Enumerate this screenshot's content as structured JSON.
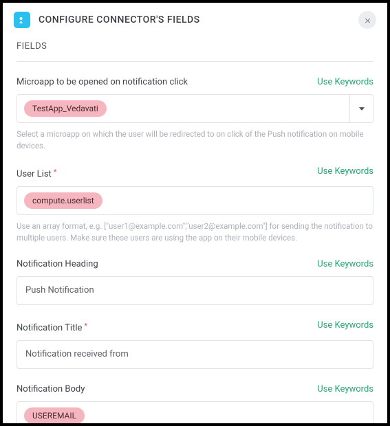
{
  "header": {
    "title": "CONFIGURE CONNECTOR'S FIELDS"
  },
  "section": {
    "label": "FIELDS"
  },
  "actions": {
    "use_keywords": "Use Keywords"
  },
  "fields": {
    "microapp": {
      "label": "Microapp to be opened on notification click",
      "value": "TestApp_Vedavati",
      "helper": "Select a microapp on which the user will be redirected to on click of the Push notification on mobile devices."
    },
    "userlist": {
      "label": "User List",
      "value": "compute.userlist",
      "helper": "Use an array format, e.g. [\"user1@example.com\",\"user2@example.com\"] for sending the notification to multiple users. Make sure these users are using the app on their mobile devices."
    },
    "heading": {
      "label": "Notification Heading",
      "value": "Push Notification"
    },
    "title": {
      "label": "Notification Title",
      "value": "Notification received from"
    },
    "body": {
      "label": "Notification Body",
      "value": "USEREMAIL"
    }
  }
}
